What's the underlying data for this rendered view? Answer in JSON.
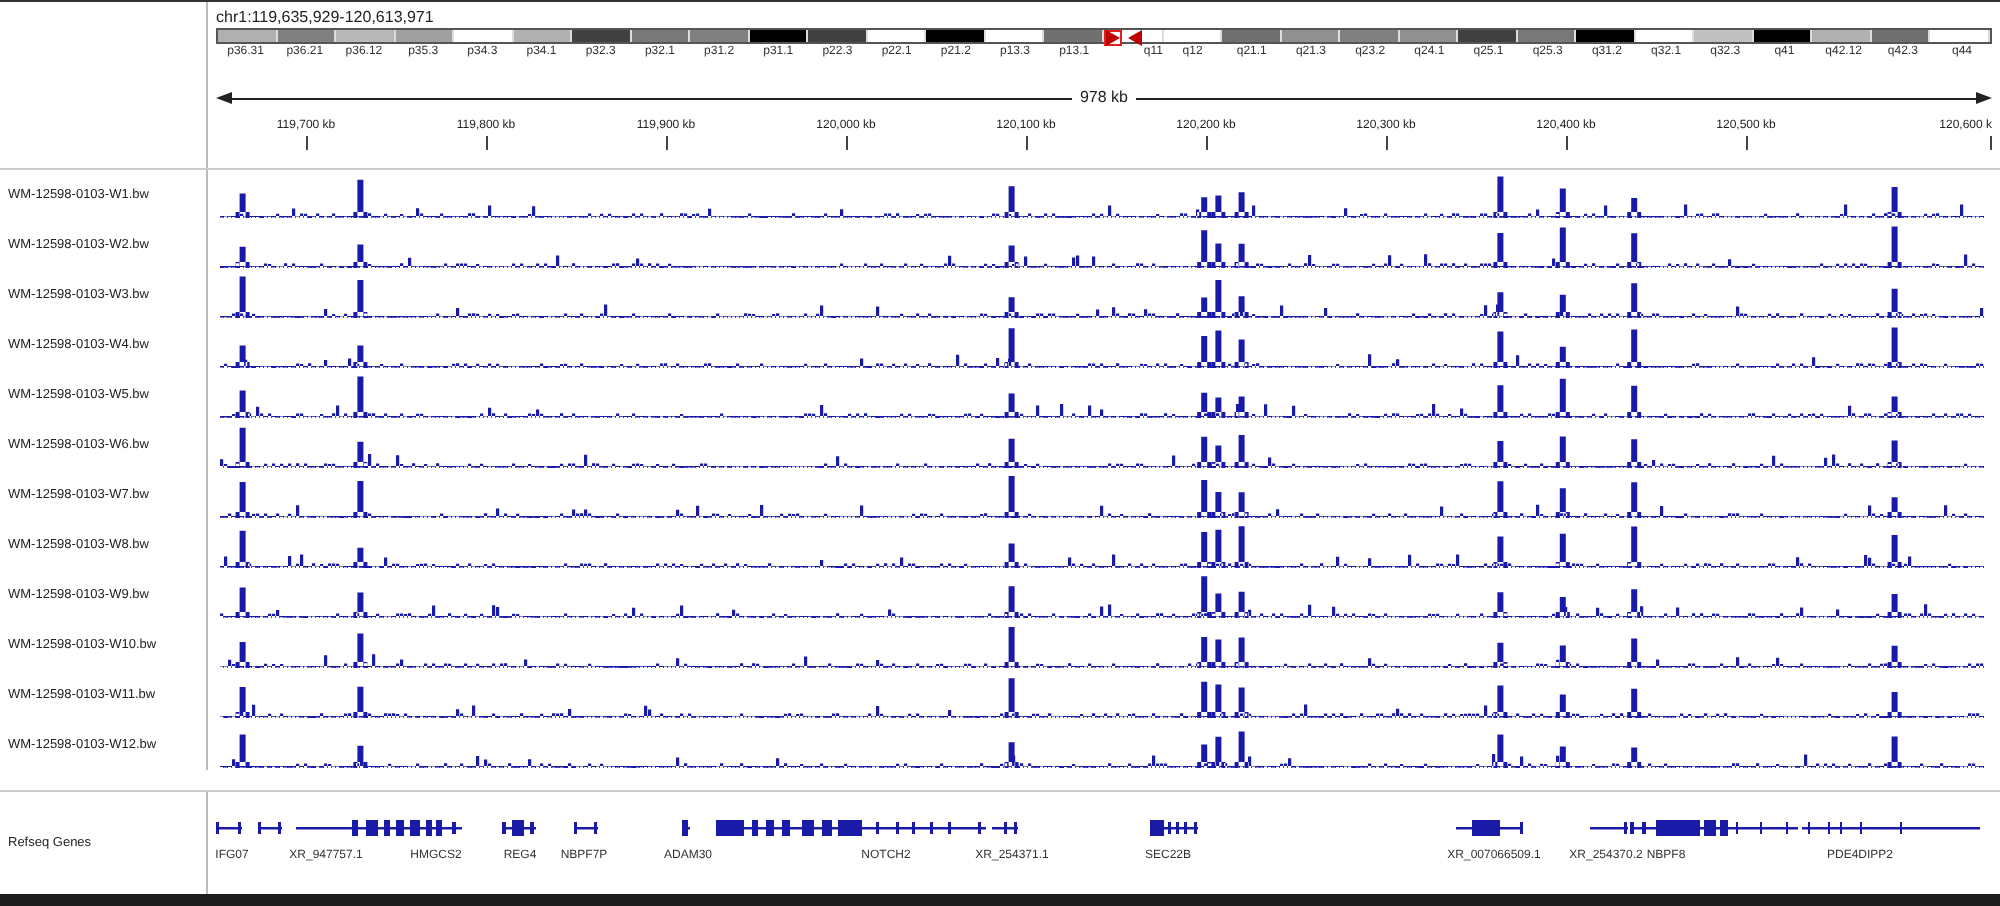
{
  "locus": "chr1:119,635,929-120,613,971",
  "ideogram": [
    {
      "label": "p36.31",
      "color": "#b0b0b0"
    },
    {
      "label": "p36.21",
      "color": "#808080"
    },
    {
      "label": "p36.12",
      "color": "#b8b8b8"
    },
    {
      "label": "p35.3",
      "color": "#a0a0a0"
    },
    {
      "label": "p34.3",
      "color": "#ffffff"
    },
    {
      "label": "p34.1",
      "color": "#b0b0b0"
    },
    {
      "label": "p32.3",
      "color": "#404040"
    },
    {
      "label": "p32.1",
      "color": "#787878"
    },
    {
      "label": "p31.2",
      "color": "#808080"
    },
    {
      "label": "p31.1",
      "color": "#000000"
    },
    {
      "label": "p22.3",
      "color": "#404040"
    },
    {
      "label": "p22.1",
      "color": "#ffffff"
    },
    {
      "label": "p21.2",
      "color": "#000000"
    },
    {
      "label": "p13.3",
      "color": "#ffffff"
    },
    {
      "label": "p13.1",
      "color": "#707070"
    },
    {
      "label": "q11",
      "color": "#ffffff"
    },
    {
      "label": "q12",
      "color": "#ffffff"
    },
    {
      "label": "q21.1",
      "color": "#707070"
    },
    {
      "label": "q21.3",
      "color": "#909090"
    },
    {
      "label": "q23.2",
      "color": "#808080"
    },
    {
      "label": "q24.1",
      "color": "#909090"
    },
    {
      "label": "q25.1",
      "color": "#404040"
    },
    {
      "label": "q25.3",
      "color": "#787878"
    },
    {
      "label": "q31.2",
      "color": "#000000"
    },
    {
      "label": "q32.1",
      "color": "#ffffff"
    },
    {
      "label": "q32.3",
      "color": "#c0c0c0"
    },
    {
      "label": "q41",
      "color": "#000000"
    },
    {
      "label": "q42.12",
      "color": "#b0b0b0"
    },
    {
      "label": "q42.3",
      "color": "#707070"
    },
    {
      "label": "q44",
      "color": "#ffffff"
    }
  ],
  "span": "978 kb",
  "ruler_ticks": [
    "119,700 kb",
    "119,800 kb",
    "119,900 kb",
    "120,000 kb",
    "120,100 kb",
    "120,200 kb",
    "120,300 kb",
    "120,400 kb",
    "120,500 kb",
    "120,600 k"
  ],
  "tracks": [
    {
      "name": "WM-12598-0103-W1.bw"
    },
    {
      "name": "WM-12598-0103-W2.bw"
    },
    {
      "name": "WM-12598-0103-W3.bw"
    },
    {
      "name": "WM-12598-0103-W4.bw"
    },
    {
      "name": "WM-12598-0103-W5.bw"
    },
    {
      "name": "WM-12598-0103-W6.bw"
    },
    {
      "name": "WM-12598-0103-W7.bw"
    },
    {
      "name": "WM-12598-0103-W8.bw"
    },
    {
      "name": "WM-12598-0103-W9.bw"
    },
    {
      "name": "WM-12598-0103-W10.bw"
    },
    {
      "name": "WM-12598-0103-W11.bw"
    },
    {
      "name": "WM-12598-0103-W12.bw"
    }
  ],
  "gene_track": {
    "name": "Refseq Genes",
    "genes": [
      {
        "label": "IFG07"
      },
      {
        "label": "XR_947757.1"
      },
      {
        "label": "HMGCS2"
      },
      {
        "label": "REG4"
      },
      {
        "label": "NBPF7P"
      },
      {
        "label": "ADAM30"
      },
      {
        "label": "NOTCH2"
      },
      {
        "label": "XR_254371.1"
      },
      {
        "label": "SEC22B"
      },
      {
        "label": "XR_007066509.1"
      },
      {
        "label": "XR_254370.2"
      },
      {
        "label": "NBPF8"
      },
      {
        "label": "PDE4DIPP2"
      }
    ]
  }
}
